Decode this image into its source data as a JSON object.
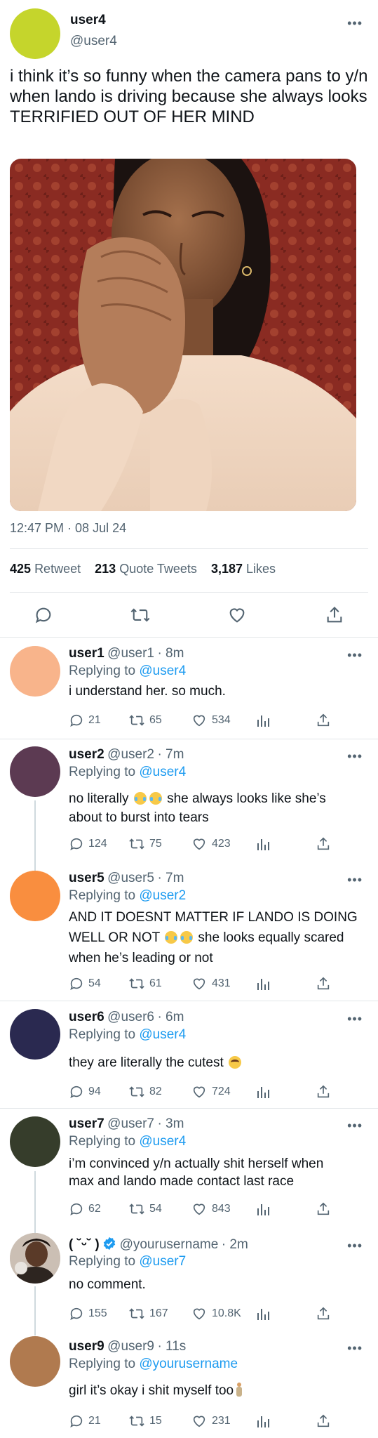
{
  "main_tweet": {
    "display_name": "user4",
    "handle": "@user4",
    "text": "i think it’s so funny when the camera pans to y/n when lando is driving because she always looks TERRIFIED OUT OF HER MIND",
    "timestamp": "12:47 PM · 08 Jul 24",
    "retweets_count": "425",
    "retweets_label": "Retweet",
    "quotes_count": "213",
    "quotes_label": "Quote Tweets",
    "likes_count": "3,187",
    "likes_label": "Likes",
    "avatar_color": "#c5d52c"
  },
  "replies": [
    {
      "name": "user1",
      "handle": "@user1",
      "time": "· 8m",
      "replying_prefix": "Replying to",
      "replying_to": "@user4",
      "lines": [
        "i understand her. so much."
      ],
      "replies": "21",
      "retweets": "65",
      "likes": "534",
      "avatar_color": "#f8b48b"
    },
    {
      "name": "user2",
      "handle": "@user2",
      "time": "· 7m",
      "replying_prefix": "Replying to",
      "replying_to": "@user4",
      "line1_a": "no literally",
      "line1_b": "she always looks like she’s",
      "line2": "about to burst into tears",
      "replies": "124",
      "retweets": "75",
      "likes": "423",
      "avatar_color": "#5c3a52"
    },
    {
      "name": "user5",
      "handle": "@user5",
      "time": "· 7m",
      "replying_prefix": "Replying to",
      "replying_to": "@user2",
      "line1": "AND IT DOESNT MATTER IF LANDO IS DOING",
      "line2_a": "WELL OR NOT",
      "line2_b": "she looks equally scared",
      "line3": "when he’s leading or not",
      "replies": "54",
      "retweets": "61",
      "likes": "431",
      "avatar_color": "#f98e3f"
    },
    {
      "name": "user6",
      "handle": "@user6",
      "time": "· 6m",
      "replying_prefix": "Replying to",
      "replying_to": "@user4",
      "line1": "they are literally the cutest",
      "replies": "94",
      "retweets": "82",
      "likes": "724",
      "avatar_color": "#2a2950"
    },
    {
      "name": "user7",
      "handle": "@user7",
      "time": "· 3m",
      "replying_prefix": "Replying to",
      "replying_to": "@user4",
      "lines": [
        "i’m convinced y/n actually shit herself when",
        "max and lando made contact last race"
      ],
      "replies": "62",
      "retweets": "54",
      "likes": "843",
      "avatar_color": "#363d2b"
    },
    {
      "name": "( ˘ᵕ˘ )",
      "handle": "@yourusername",
      "time": "· 2m",
      "replying_prefix": "Replying to",
      "replying_to": "@user7",
      "lines": [
        "no comment."
      ],
      "replies": "155",
      "retweets": "167",
      "likes": "10.8K",
      "avatar_color": "#7a5a44"
    },
    {
      "name": "user9",
      "handle": "@user9",
      "time": "· 11s",
      "replying_prefix": "Replying to",
      "replying_to": "@yourusername",
      "line1": "girl it’s okay i shit myself too",
      "replies": "21",
      "retweets": "15",
      "likes": "231",
      "avatar_color": "#b07a4f"
    }
  ]
}
